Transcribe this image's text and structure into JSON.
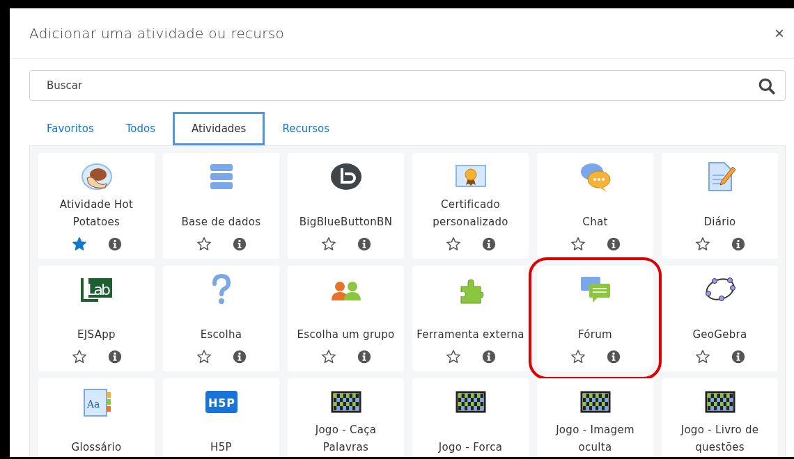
{
  "dialog": {
    "title": "Adicionar uma atividade ou recurso",
    "close": "×"
  },
  "search": {
    "placeholder": "Buscar"
  },
  "tabs": [
    {
      "label": "Favoritos",
      "selected": false
    },
    {
      "label": "Todos",
      "selected": false
    },
    {
      "label": "Atividades",
      "selected": true
    },
    {
      "label": "Recursos",
      "selected": false
    }
  ],
  "tiles": [
    {
      "kind": "potato",
      "label": "Atividade Hot Potatoes",
      "starred": true,
      "highlighted": false
    },
    {
      "kind": "database",
      "label": "Base de dados",
      "starred": false,
      "highlighted": false
    },
    {
      "kind": "bbb",
      "label": "BigBlueButtonBN",
      "starred": false,
      "highlighted": false
    },
    {
      "kind": "certificate",
      "label": "Certificado personalizado",
      "starred": false,
      "highlighted": false
    },
    {
      "kind": "chat",
      "label": "Chat",
      "starred": false,
      "highlighted": false
    },
    {
      "kind": "diary",
      "label": "Diário",
      "starred": false,
      "highlighted": false
    },
    {
      "kind": "lab",
      "label": "EJSApp",
      "icon_text": "Lab",
      "starred": false,
      "highlighted": false
    },
    {
      "kind": "question",
      "label": "Escolha",
      "starred": false,
      "highlighted": false
    },
    {
      "kind": "group",
      "label": "Escolha um grupo",
      "starred": false,
      "highlighted": false
    },
    {
      "kind": "puzzle",
      "label": "Ferramenta externa",
      "starred": false,
      "highlighted": false
    },
    {
      "kind": "forum",
      "label": "Fórum",
      "starred": false,
      "highlighted": true
    },
    {
      "kind": "geogebra",
      "label": "GeoGebra",
      "starred": false,
      "highlighted": false
    },
    {
      "kind": "glossary",
      "label": "Glossário",
      "icon_text": "Aa",
      "highlighted": false
    },
    {
      "kind": "h5p",
      "label": "H5P",
      "icon_text": "H5P",
      "highlighted": false
    },
    {
      "kind": "game",
      "label": "Jogo - Caça Palavras",
      "highlighted": false
    },
    {
      "kind": "game",
      "label": "Jogo - Forca",
      "highlighted": false
    },
    {
      "kind": "game",
      "label": "Jogo - Imagem oculta",
      "highlighted": false
    },
    {
      "kind": "game",
      "label": "Jogo - Livro de questões",
      "highlighted": false
    }
  ]
}
